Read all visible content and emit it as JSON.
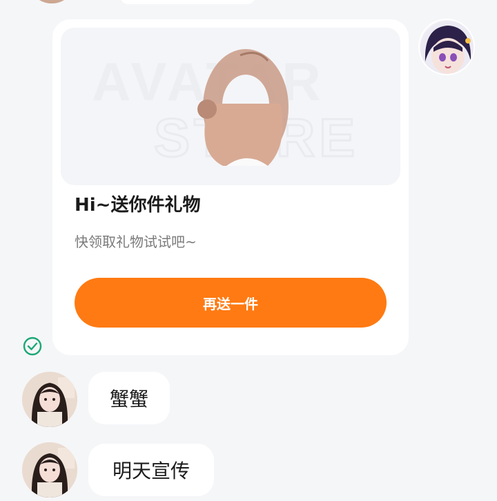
{
  "card": {
    "title": "Hi~送你件礼物",
    "subtitle": "快领取礼物试试吧~",
    "button_label": "再送一件",
    "image_text_line1": "AVATAR",
    "image_text_line2": "STORE"
  },
  "messages": [
    {
      "text": "蟹蟹"
    },
    {
      "text": "明天宣传"
    }
  ],
  "colors": {
    "accent": "#ff7a12",
    "read_check": "#1aa874"
  },
  "icons": {
    "read_status": "check-circle-icon"
  }
}
